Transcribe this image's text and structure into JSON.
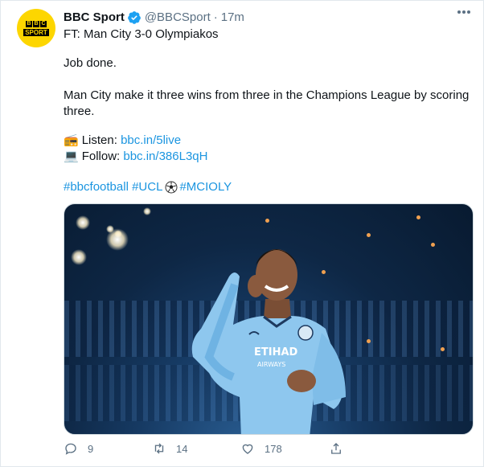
{
  "tweet": {
    "avatar": {
      "icon": "bbc-sport-logo",
      "letters": [
        "B",
        "B",
        "C"
      ],
      "word": "SPORT",
      "bg": "#fdd600"
    },
    "author_name": "BBC Sport",
    "handle": "@BBCSport",
    "separator": "·",
    "time": "17m",
    "lines": {
      "line1": "FT: Man City 3-0 Olympiakos",
      "line2": "Job done.",
      "line3": "Man City make it three wins from three in the Champions League by scoring three.",
      "listen_label": "Listen:",
      "listen_link": "bbc.in/5live",
      "follow_label": "Follow:",
      "follow_link": "bbc.in/386L3qH",
      "tag1": "#bbcfootball",
      "tag2": "#UCL",
      "tag3": "#MCIOLY"
    },
    "media": {
      "kind": "photo",
      "shirt_text": "ETIHAD AIRWAYS"
    },
    "actions": {
      "replies": "9",
      "retweets": "14",
      "likes": "178"
    }
  },
  "colors": {
    "link": "#1b95e0",
    "verified": "#1da1f2",
    "muted": "#5b7083"
  }
}
